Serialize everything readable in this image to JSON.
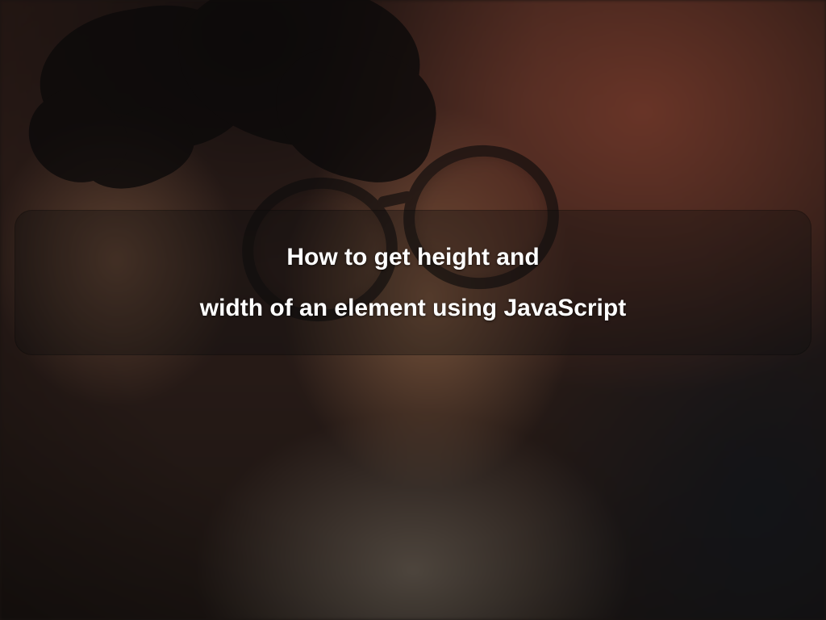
{
  "title": {
    "line1": "How to get height and",
    "line2": "width of an element using JavaScript"
  }
}
